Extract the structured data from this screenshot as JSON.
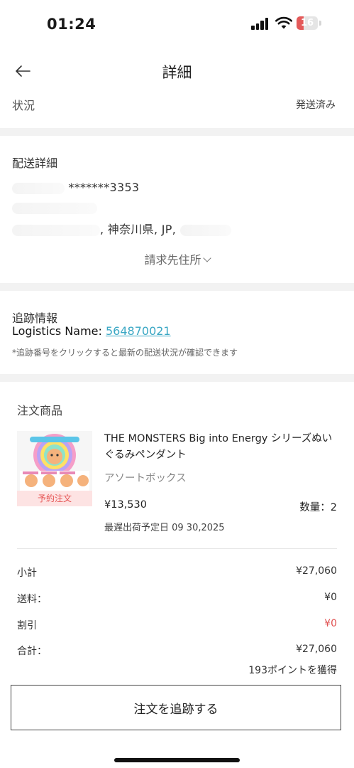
{
  "status_bar": {
    "time": "01:24",
    "battery": "16"
  },
  "nav": {
    "title": "詳細"
  },
  "status_row": {
    "label": "状況",
    "value": "発送済み"
  },
  "delivery": {
    "title": "配送詳細",
    "phone_suffix": "*******3353",
    "address_visible": ", 神奈川県, JP,",
    "billing_toggle": "請求先住所"
  },
  "tracking": {
    "title": "追跡情報",
    "logistics_label": "Logistics Name: ",
    "tracking_number": "564870021",
    "note": "*追跡番号をクリックすると最新の配送状況が確認できます"
  },
  "order": {
    "title": "注文商品",
    "product": {
      "name": "THE MONSTERS Big into Energy シリーズぬいぐるみペンダント",
      "variant": "アソートボックス",
      "badge": "予約注文",
      "price": "¥13,530",
      "quantity": "数量：2",
      "ship_date": "最遅出荷予定日 09 30,2025"
    }
  },
  "summary": {
    "subtotal_label": "小計",
    "subtotal": "¥27,060",
    "shipping_label": "送料：",
    "shipping": "¥0",
    "discount_label": "割引",
    "discount": "¥0",
    "total_label": "合計：",
    "total": "¥27,060",
    "points": "193ポイントを獲得"
  },
  "actions": {
    "track_order": "注文を追跡する"
  },
  "colors": {
    "link": "#3aa7c4",
    "discount": "#e05050",
    "badge_bg": "#fde3e3",
    "badge_text": "#e65555"
  }
}
